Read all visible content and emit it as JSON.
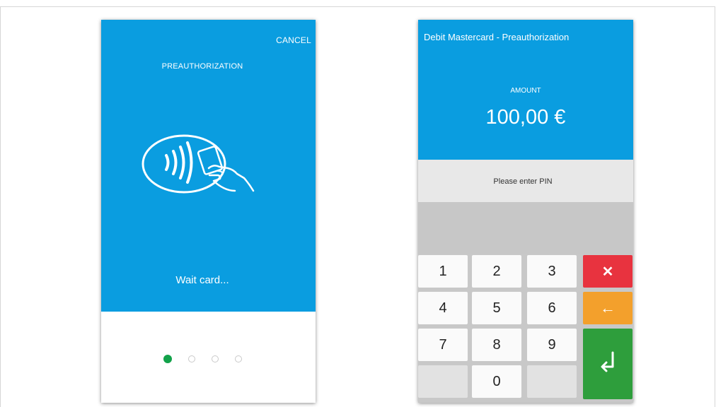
{
  "left_screen": {
    "cancel_label": "CANCEL",
    "title": "PREAUTHORIZATION",
    "status_text": "Wait card...",
    "icon": "contactless-card-icon",
    "page_indicator": {
      "total": 4,
      "active_index": 0
    },
    "colors": {
      "primary": "#0a9de0",
      "active_dot": "#12a24a"
    }
  },
  "right_screen": {
    "title": "Debit Mastercard - Preauthorization",
    "amount_label": "AMOUNT",
    "amount_value": "100,00  €",
    "prompt": "Please enter PIN",
    "keypad": {
      "digits": [
        "1",
        "2",
        "3",
        "4",
        "5",
        "6",
        "7",
        "8",
        "9",
        "0"
      ],
      "cancel_symbol": "✕",
      "backspace_symbol": "←",
      "enter_icon": "enter-return-icon"
    },
    "colors": {
      "cancel": "#e8333f",
      "backspace": "#f3a02c",
      "enter": "#2e9e3c"
    }
  }
}
